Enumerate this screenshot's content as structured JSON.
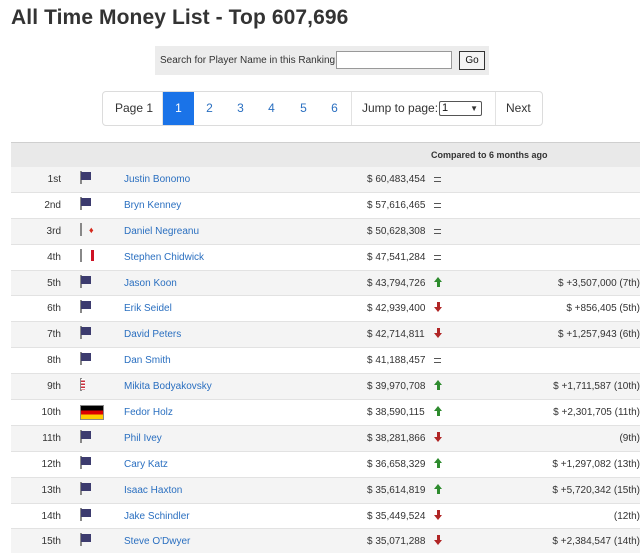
{
  "page": {
    "title": "All Time Money List - Top 607,696"
  },
  "search": {
    "label": "Search for Player Name in this Ranking",
    "value": "",
    "go_label": "Go"
  },
  "pager": {
    "page_label": "Page 1",
    "pages": [
      "1",
      "2",
      "3",
      "4",
      "5",
      "6"
    ],
    "active_page": "1",
    "jump_label": "Jump to page:",
    "jump_value": "1",
    "next_label": "Next"
  },
  "table": {
    "compare_header": "Compared to 6 months ago",
    "rows": [
      {
        "rank": "1st",
        "flag": "usa-flag",
        "name": "Justin Bonomo",
        "amount": "$ 60,483,454",
        "trend": "same",
        "change": ""
      },
      {
        "rank": "2nd",
        "flag": "usa-flag",
        "name": "Bryn Kenney",
        "amount": "$ 57,616,465",
        "trend": "same",
        "change": ""
      },
      {
        "rank": "3rd",
        "flag": "canada-flag",
        "name": "Daniel Negreanu",
        "amount": "$ 50,628,308",
        "trend": "same",
        "change": ""
      },
      {
        "rank": "4th",
        "flag": "england-flag",
        "name": "Stephen Chidwick",
        "amount": "$ 47,541,284",
        "trend": "same",
        "change": ""
      },
      {
        "rank": "5th",
        "flag": "usa-flag",
        "name": "Jason Koon",
        "amount": "$ 43,794,726",
        "trend": "up",
        "change": "$ +3,507,000 (7th)"
      },
      {
        "rank": "6th",
        "flag": "usa-flag",
        "name": "Erik Seidel",
        "amount": "$ 42,939,400",
        "trend": "down",
        "change": "$ +856,405 (5th)"
      },
      {
        "rank": "7th",
        "flag": "usa-flag",
        "name": "David Peters",
        "amount": "$ 42,714,811",
        "trend": "down",
        "change": "$ +1,257,943 (6th)"
      },
      {
        "rank": "8th",
        "flag": "usa-flag",
        "name": "Dan Smith",
        "amount": "$ 41,188,457",
        "trend": "same",
        "change": ""
      },
      {
        "rank": "9th",
        "flag": "belarus-flag",
        "name": "Mikita Bodyakovsky",
        "amount": "$ 39,970,708",
        "trend": "up",
        "change": "$ +1,711,587 (10th)"
      },
      {
        "rank": "10th",
        "flag": "germany-flag",
        "name": "Fedor Holz",
        "amount": "$ 38,590,115",
        "trend": "up",
        "change": "$ +2,301,705 (11th)"
      },
      {
        "rank": "11th",
        "flag": "usa-flag",
        "name": "Phil Ivey",
        "amount": "$ 38,281,866",
        "trend": "down",
        "change": "(9th)"
      },
      {
        "rank": "12th",
        "flag": "usa-flag",
        "name": "Cary Katz",
        "amount": "$ 36,658,329",
        "trend": "up",
        "change": "$ +1,297,082 (13th)"
      },
      {
        "rank": "13th",
        "flag": "usa-flag",
        "name": "Isaac Haxton",
        "amount": "$ 35,614,819",
        "trend": "up",
        "change": "$ +5,720,342 (15th)"
      },
      {
        "rank": "14th",
        "flag": "usa-flag",
        "name": "Jake Schindler",
        "amount": "$ 35,449,524",
        "trend": "down",
        "change": "(12th)"
      },
      {
        "rank": "15th",
        "flag": "usa-flag",
        "name": "Steve O'Dwyer",
        "amount": "$ 35,071,288",
        "trend": "down",
        "change": "$ +2,384,547 (14th)"
      }
    ]
  }
}
